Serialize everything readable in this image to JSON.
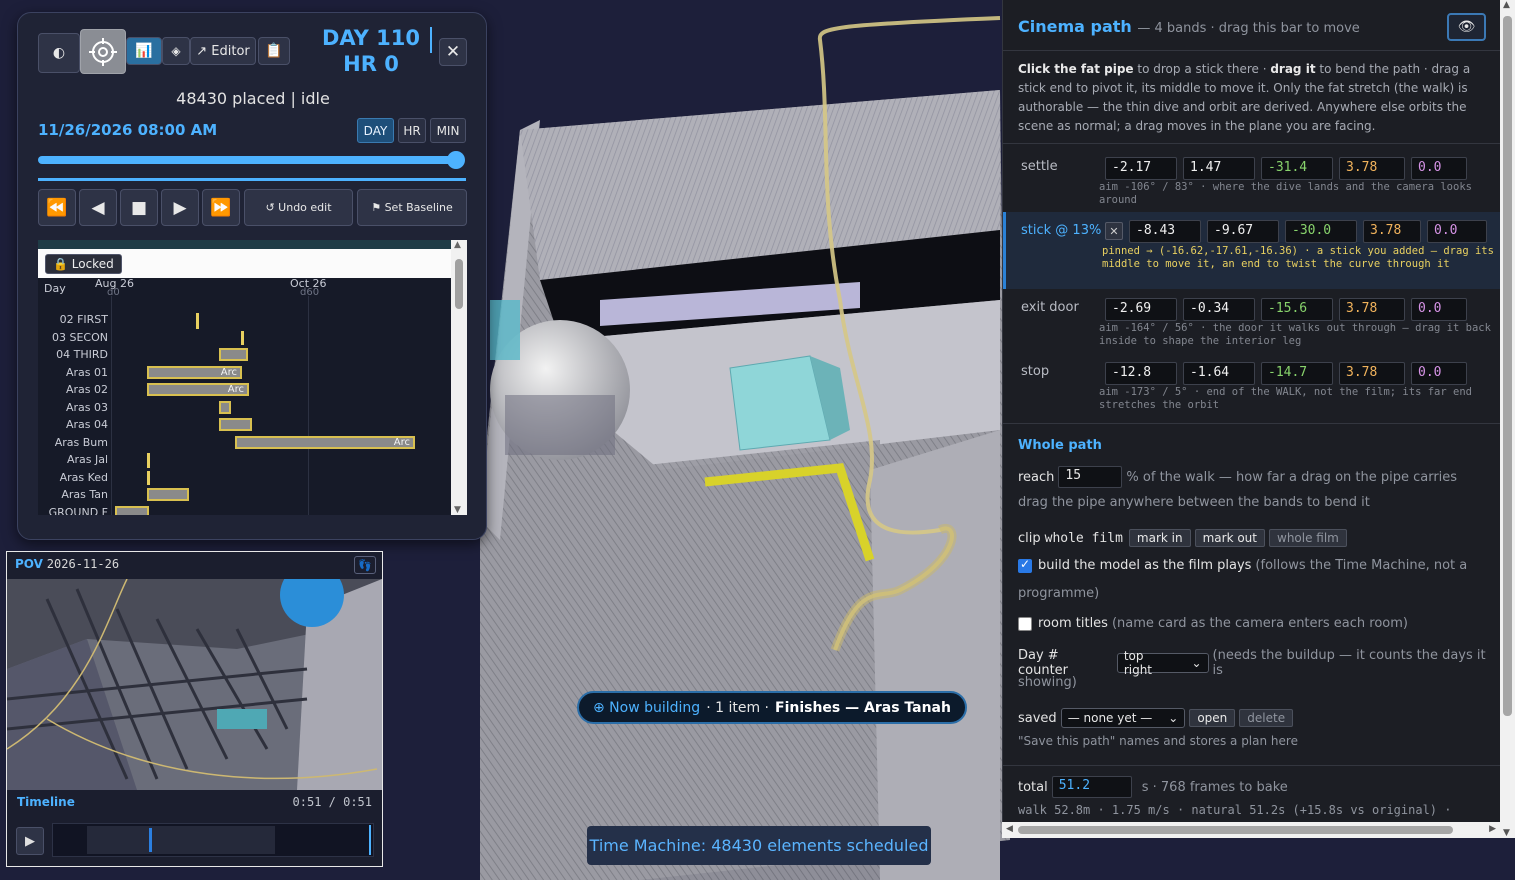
{
  "time_machine": {
    "editor_label": "↗ Editor",
    "day_label": "DAY 110",
    "hr_label": "HR 0",
    "status": "48430 placed | idle",
    "datetime": "11/26/2026 08:00 AM",
    "units": [
      "DAY",
      "HR",
      "MIN"
    ],
    "active_unit": "DAY",
    "slider_fraction": 0.98,
    "undo_label": "↺ Undo edit",
    "baseline_label": "⚑ Set Baseline"
  },
  "gantt": {
    "locked_label": "🔒 Locked",
    "axis_label": "Day",
    "date_ticks": [
      {
        "date": "Aug 26",
        "sub": "d0"
      },
      {
        "date": "Oct 26",
        "sub": "d60"
      }
    ],
    "rows": [
      {
        "label": "02 FIRST",
        "arc": ""
      },
      {
        "label": "03 SECON",
        "arc": ""
      },
      {
        "label": "04 THIRD",
        "arc": ""
      },
      {
        "label": "Aras 01",
        "arc": "Arc"
      },
      {
        "label": "Aras 02",
        "arc": "Arc"
      },
      {
        "label": "Aras 03",
        "arc": ""
      },
      {
        "label": "Aras 04",
        "arc": ""
      },
      {
        "label": "Aras Bum",
        "arc": "Arc"
      },
      {
        "label": "Aras Jal",
        "arc": ""
      },
      {
        "label": "Aras Ked",
        "arc": ""
      },
      {
        "label": "Aras Tan",
        "arc": ""
      },
      {
        "label": "GROUND F",
        "arc": ""
      }
    ]
  },
  "pov": {
    "label": "POV",
    "date": "2026-11-26",
    "timeline_label": "Timeline",
    "time": "0:51 / 0:51"
  },
  "now_building": {
    "lead": "⊕ Now building",
    "count": "· 1 item ·",
    "name": "Finishes — Aras Tanah"
  },
  "toast": "Time Machine: 48430 elements scheduled",
  "cinema": {
    "title": "Cinema path",
    "subtitle": "— 4 bands · drag this bar to move",
    "help_bold1": "Click the fat pipe",
    "help_t1": " to drop a stick there · ",
    "help_bold2": "drag it",
    "help_t2": " to bend the path · drag a stick end to pivot it, its middle to move it. Only the fat stretch (the walk) is authorable — the thin dive and orbit are derived. Anywhere else orbits the scene as normal; a drag moves in the plane you are facing.",
    "bands": [
      {
        "name": "settle",
        "values": [
          "-2.17",
          "1.47",
          "-31.4",
          "3.78",
          "0.0"
        ],
        "note": "aim -106° / 83° · where the dive lands and the camera looks around"
      },
      {
        "name": "stick @ 13%",
        "values": [
          "-8.43",
          "-9.67",
          "-30.0",
          "3.78",
          "0.0"
        ],
        "note": "pinned → (-16.62,-17.61,-16.36) · a stick you added — drag its middle to move it, an end to twist the curve through it"
      },
      {
        "name": "exit door",
        "values": [
          "-2.69",
          "-0.34",
          "-15.6",
          "3.78",
          "0.0"
        ],
        "note": "aim -164° / 56° · the door it walks out through — drag it back inside to shape the interior leg"
      },
      {
        "name": "stop",
        "values": [
          "-12.8",
          "-1.64",
          "-14.7",
          "3.78",
          "0.0"
        ],
        "note": "aim -173° / 5° · end of the WALK, not the film; its far end stretches the orbit"
      }
    ],
    "whole_path": "Whole path",
    "reach_label": "reach",
    "reach_value": "15",
    "reach_suffix": "% of the walk — how far a drag on the pipe carries",
    "reach_hint": "drag the pipe anywhere between the bands to bend it",
    "clip_label": "clip",
    "clip_value": "whole film",
    "mark_in": "mark in",
    "mark_out": "mark out",
    "whole_film": "whole film",
    "build_label": "build the model as the film plays",
    "build_note1": "(follows the Time Machine, not a",
    "build_note2": "programme)",
    "build_checked": true,
    "titles_label": "room titles",
    "titles_note": "(name card as the camera enters each room)",
    "titles_checked": false,
    "counter_label": "Day # counter",
    "counter_value": "top right",
    "counter_note1": "(needs the buildup — it counts the days it is",
    "counter_note2": "showing)",
    "saved_label": "saved",
    "saved_value": "— none yet —",
    "open_label": "open",
    "delete_label": "delete",
    "saved_hint": "\"Save this path\" names and stores a plan here",
    "total_label": "total",
    "total_value": "51.2",
    "total_suffix": "s · 768 frames to bake",
    "total_note": "walk 52.8m · 1.75 m/s · natural 51.2s (+15.8s vs original) ·"
  },
  "colors": {
    "accent": "#4db2ff",
    "panel": "#1f2335",
    "highlight": "#e8d060"
  }
}
